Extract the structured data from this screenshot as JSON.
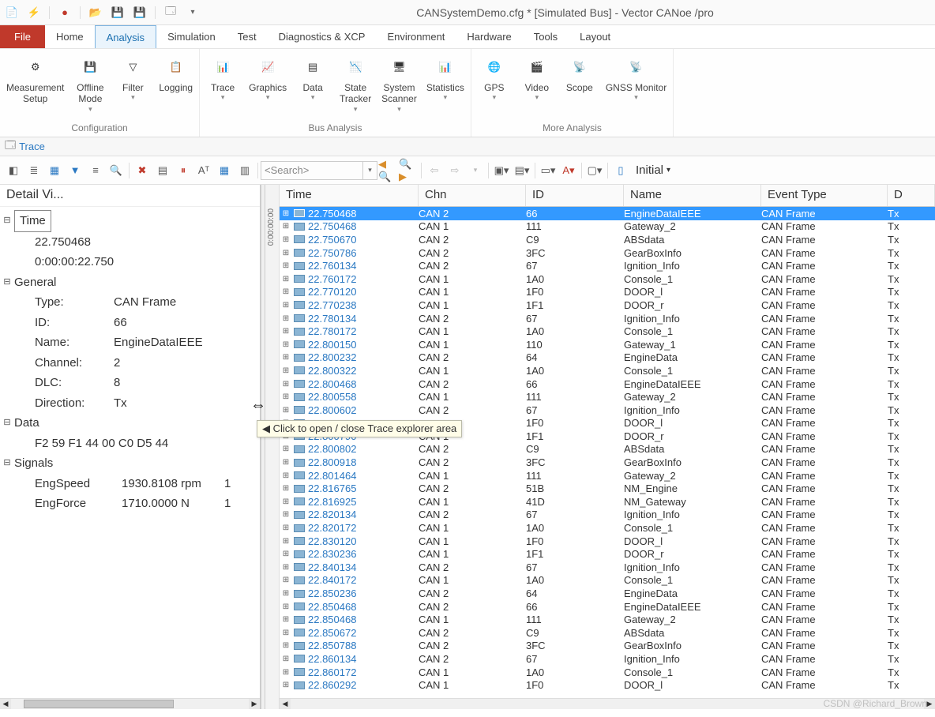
{
  "title": "CANSystemDemo.cfg * [Simulated Bus] - Vector CANoe /pro",
  "menu": [
    "File",
    "Home",
    "Analysis",
    "Simulation",
    "Test",
    "Diagnostics & XCP",
    "Environment",
    "Hardware",
    "Tools",
    "Layout"
  ],
  "ribbon": {
    "groups": [
      {
        "label": "Configuration",
        "buttons": [
          {
            "label": "Measurement\nSetup",
            "drop": false
          },
          {
            "label": "Offline\nMode",
            "drop": true
          },
          {
            "label": "Filter",
            "drop": true
          },
          {
            "label": "Logging",
            "drop": false
          }
        ]
      },
      {
        "label": "Bus Analysis",
        "buttons": [
          {
            "label": "Trace",
            "drop": true
          },
          {
            "label": "Graphics",
            "drop": true
          },
          {
            "label": "Data",
            "drop": true
          },
          {
            "label": "State\nTracker",
            "drop": true
          },
          {
            "label": "System\nScanner",
            "drop": true
          },
          {
            "label": "Statistics",
            "drop": true
          }
        ]
      },
      {
        "label": "More Analysis",
        "buttons": [
          {
            "label": "GPS",
            "drop": true
          },
          {
            "label": "Video",
            "drop": true
          },
          {
            "label": "Scope",
            "drop": false
          },
          {
            "label": "GNSS Monitor",
            "drop": true
          }
        ]
      }
    ]
  },
  "panelTab": "Trace",
  "search_placeholder": "<Search>",
  "toggle_label": "Initial",
  "detail": {
    "header": "Detail Vi...",
    "time_label": "Time",
    "time_val": "22.750468",
    "time_abs": "0:00:00:22.750",
    "general_label": "General",
    "general": [
      {
        "k": "Type:",
        "v": "CAN Frame"
      },
      {
        "k": "ID:",
        "v": "66"
      },
      {
        "k": "Name:",
        "v": "EngineDataIEEE"
      },
      {
        "k": "Channel:",
        "v": "2"
      },
      {
        "k": "DLC:",
        "v": "8"
      },
      {
        "k": "Direction:",
        "v": "Tx"
      }
    ],
    "data_label": "Data",
    "data_bytes": "F2  59  F1  44  00  C0  D5  44",
    "signals_label": "Signals",
    "signals": [
      {
        "name": "EngSpeed",
        "val": "1930.8108 rpm",
        "extra": "1"
      },
      {
        "name": "EngForce",
        "val": "1710.0000 N",
        "extra": "1"
      }
    ]
  },
  "ruler": "0:00:00:00",
  "tooltip": "Click to open / close Trace explorer area",
  "columns": [
    "Time",
    "Chn",
    "ID",
    "Name",
    "Event Type",
    "D"
  ],
  "rows": [
    {
      "t": "22.750468",
      "c": "CAN 2",
      "id": "66",
      "n": "EngineDataIEEE",
      "e": "CAN Frame",
      "d": "Tx",
      "sel": true
    },
    {
      "t": "22.750468",
      "c": "CAN 1",
      "id": "111",
      "n": "Gateway_2",
      "e": "CAN Frame",
      "d": "Tx"
    },
    {
      "t": "22.750670",
      "c": "CAN 2",
      "id": "C9",
      "n": "ABSdata",
      "e": "CAN Frame",
      "d": "Tx"
    },
    {
      "t": "22.750786",
      "c": "CAN 2",
      "id": "3FC",
      "n": "GearBoxInfo",
      "e": "CAN Frame",
      "d": "Tx"
    },
    {
      "t": "22.760134",
      "c": "CAN 2",
      "id": "67",
      "n": "Ignition_Info",
      "e": "CAN Frame",
      "d": "Tx"
    },
    {
      "t": "22.760172",
      "c": "CAN 1",
      "id": "1A0",
      "n": "Console_1",
      "e": "CAN Frame",
      "d": "Tx"
    },
    {
      "t": "22.770120",
      "c": "CAN 1",
      "id": "1F0",
      "n": "DOOR_l",
      "e": "CAN Frame",
      "d": "Tx"
    },
    {
      "t": "22.770238",
      "c": "CAN 1",
      "id": "1F1",
      "n": "DOOR_r",
      "e": "CAN Frame",
      "d": "Tx"
    },
    {
      "t": "22.780134",
      "c": "CAN 2",
      "id": "67",
      "n": "Ignition_Info",
      "e": "CAN Frame",
      "d": "Tx"
    },
    {
      "t": "22.780172",
      "c": "CAN 1",
      "id": "1A0",
      "n": "Console_1",
      "e": "CAN Frame",
      "d": "Tx"
    },
    {
      "t": "22.800150",
      "c": "CAN 1",
      "id": "110",
      "n": "Gateway_1",
      "e": "CAN Frame",
      "d": "Tx"
    },
    {
      "t": "22.800232",
      "c": "CAN 2",
      "id": "64",
      "n": "EngineData",
      "e": "CAN Frame",
      "d": "Tx"
    },
    {
      "t": "22.800322",
      "c": "CAN 1",
      "id": "1A0",
      "n": "Console_1",
      "e": "CAN Frame",
      "d": "Tx"
    },
    {
      "t": "22.800468",
      "c": "CAN 2",
      "id": "66",
      "n": "EngineDataIEEE",
      "e": "CAN Frame",
      "d": "Tx"
    },
    {
      "t": "22.800558",
      "c": "CAN 1",
      "id": "111",
      "n": "Gateway_2",
      "e": "CAN Frame",
      "d": "Tx"
    },
    {
      "t": "22.800602",
      "c": "CAN 2",
      "id": "67",
      "n": "Ignition_Info",
      "e": "CAN Frame",
      "d": "Tx"
    },
    {
      "t": "",
      "c": "",
      "id": "1F0",
      "n": "DOOR_l",
      "e": "CAN Frame",
      "d": "Tx"
    },
    {
      "t": "22.800790",
      "c": "CAN 1",
      "id": "1F1",
      "n": "DOOR_r",
      "e": "CAN Frame",
      "d": "Tx"
    },
    {
      "t": "22.800802",
      "c": "CAN 2",
      "id": "C9",
      "n": "ABSdata",
      "e": "CAN Frame",
      "d": "Tx"
    },
    {
      "t": "22.800918",
      "c": "CAN 2",
      "id": "3FC",
      "n": "GearBoxInfo",
      "e": "CAN Frame",
      "d": "Tx"
    },
    {
      "t": "22.801464",
      "c": "CAN 1",
      "id": "111",
      "n": "Gateway_2",
      "e": "CAN Frame",
      "d": "Tx"
    },
    {
      "t": "22.816765",
      "c": "CAN 2",
      "id": "51B",
      "n": "NM_Engine",
      "e": "CAN Frame",
      "d": "Tx"
    },
    {
      "t": "22.816925",
      "c": "CAN 1",
      "id": "41D",
      "n": "NM_Gateway",
      "e": "CAN Frame",
      "d": "Tx"
    },
    {
      "t": "22.820134",
      "c": "CAN 2",
      "id": "67",
      "n": "Ignition_Info",
      "e": "CAN Frame",
      "d": "Tx"
    },
    {
      "t": "22.820172",
      "c": "CAN 1",
      "id": "1A0",
      "n": "Console_1",
      "e": "CAN Frame",
      "d": "Tx"
    },
    {
      "t": "22.830120",
      "c": "CAN 1",
      "id": "1F0",
      "n": "DOOR_l",
      "e": "CAN Frame",
      "d": "Tx"
    },
    {
      "t": "22.830236",
      "c": "CAN 1",
      "id": "1F1",
      "n": "DOOR_r",
      "e": "CAN Frame",
      "d": "Tx"
    },
    {
      "t": "22.840134",
      "c": "CAN 2",
      "id": "67",
      "n": "Ignition_Info",
      "e": "CAN Frame",
      "d": "Tx"
    },
    {
      "t": "22.840172",
      "c": "CAN 1",
      "id": "1A0",
      "n": "Console_1",
      "e": "CAN Frame",
      "d": "Tx"
    },
    {
      "t": "22.850236",
      "c": "CAN 2",
      "id": "64",
      "n": "EngineData",
      "e": "CAN Frame",
      "d": "Tx"
    },
    {
      "t": "22.850468",
      "c": "CAN 2",
      "id": "66",
      "n": "EngineDataIEEE",
      "e": "CAN Frame",
      "d": "Tx"
    },
    {
      "t": "22.850468",
      "c": "CAN 1",
      "id": "111",
      "n": "Gateway_2",
      "e": "CAN Frame",
      "d": "Tx"
    },
    {
      "t": "22.850672",
      "c": "CAN 2",
      "id": "C9",
      "n": "ABSdata",
      "e": "CAN Frame",
      "d": "Tx"
    },
    {
      "t": "22.850788",
      "c": "CAN 2",
      "id": "3FC",
      "n": "GearBoxInfo",
      "e": "CAN Frame",
      "d": "Tx"
    },
    {
      "t": "22.860134",
      "c": "CAN 2",
      "id": "67",
      "n": "Ignition_Info",
      "e": "CAN Frame",
      "d": "Tx"
    },
    {
      "t": "22.860172",
      "c": "CAN 1",
      "id": "1A0",
      "n": "Console_1",
      "e": "CAN Frame",
      "d": "Tx"
    },
    {
      "t": "22.860292",
      "c": "CAN 1",
      "id": "1F0",
      "n": "DOOR_l",
      "e": "CAN Frame",
      "d": "Tx"
    }
  ],
  "watermark": "CSDN @Richard_Brown"
}
